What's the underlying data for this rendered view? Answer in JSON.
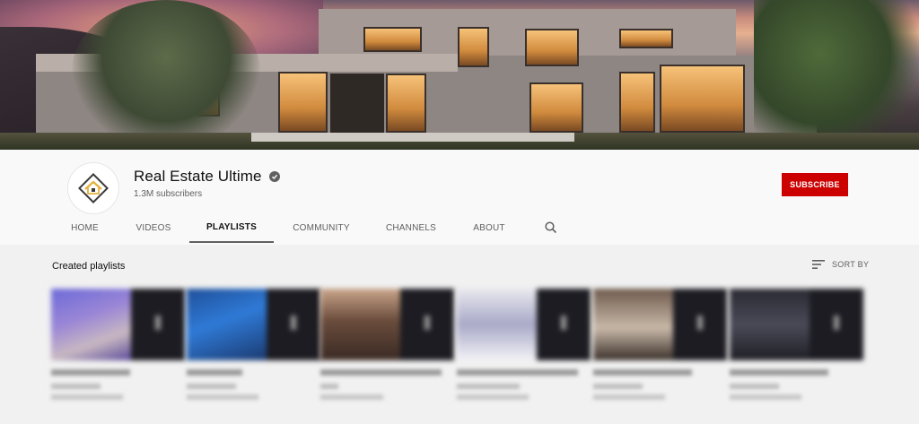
{
  "channel": {
    "name": "Real Estate Ultime",
    "subscribers": "1.3M subscribers",
    "subscribe_label": "SUBSCRIBE"
  },
  "tabs": [
    {
      "label": "HOME",
      "active": false
    },
    {
      "label": "VIDEOS",
      "active": false
    },
    {
      "label": "PLAYLISTS",
      "active": true
    },
    {
      "label": "COMMUNITY",
      "active": false
    },
    {
      "label": "CHANNELS",
      "active": false
    },
    {
      "label": "ABOUT",
      "active": false
    }
  ],
  "icons": {
    "search": "search-icon",
    "sort": "sort-icon",
    "verified": "verified-check-icon"
  },
  "section": {
    "title": "Created playlists",
    "sort_label": "SORT BY"
  },
  "colors": {
    "subscribe": "#cc0000",
    "text_primary": "#0f0f0f",
    "text_secondary": "#606060",
    "page_bg": "#f9f9f9",
    "content_bg": "#f1f1f1"
  }
}
